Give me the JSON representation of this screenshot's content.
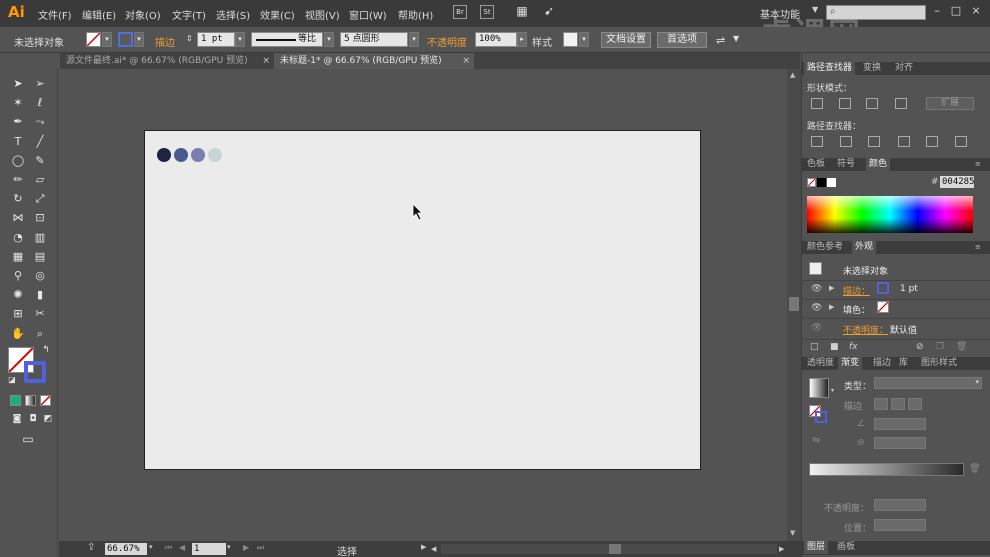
{
  "app": {
    "logo": "Ai",
    "workspace": "基本功能"
  },
  "menu": [
    "文件(F)",
    "编辑(E)",
    "对象(O)",
    "文字(T)",
    "选择(S)",
    "效果(C)",
    "视图(V)",
    "窗口(W)",
    "帮助(H)"
  ],
  "menubar_buttons": {
    "br": "Br",
    "st": "St"
  },
  "watermark": "虎课网",
  "control": {
    "selection": "未选择对象",
    "stroke_label": "描边",
    "stroke_value": "1 pt",
    "stroke_profile": "等比",
    "brush": "5 点圆形",
    "opacity_label": "不透明度",
    "opacity_value": "100%",
    "style_label": "样式",
    "doc_setup": "文档设置",
    "prefs": "首选项"
  },
  "tabs": [
    {
      "label": "源文件最终.ai* @ 66.67% (RGB/GPU 预览)",
      "close": "×"
    },
    {
      "label": "未标题-1* @ 66.67% (RGB/GPU 预览)",
      "close": "×"
    }
  ],
  "tools": [
    "selection-icon",
    "direct-selection-icon",
    "magic-wand-icon",
    "lasso-icon",
    "pen-icon",
    "curvature-icon",
    "type-icon",
    "line-icon",
    "ellipse-icon",
    "paintbrush-icon",
    "pencil-icon",
    "eraser-icon",
    "rotate-icon",
    "scale-icon",
    "width-icon",
    "free-transform-icon",
    "shape-builder-icon",
    "perspective-icon",
    "mesh-icon",
    "gradient-icon",
    "eyedropper-icon",
    "blend-icon",
    "symbol-sprayer-icon",
    "column-graph-icon",
    "artboard-icon",
    "slice-icon",
    "hand-icon",
    "zoom-icon"
  ],
  "swatches": [
    "#1f2440",
    "#4a5a90",
    "#7b7fb0",
    "#c9d6d8"
  ],
  "status": {
    "zoom": "66.67%",
    "page": "1",
    "tool": "选择"
  },
  "panels": {
    "pathfinder_tabs": [
      "路径查找器",
      "变换",
      "对齐"
    ],
    "shape_modes": "形状模式：",
    "expand": "扩展",
    "pathfinders": "路径查找器：",
    "color_tabs": [
      "色板",
      "符号",
      "颜色"
    ],
    "hex": "004285",
    "appearance_tabs": [
      "颜色参考",
      "外观"
    ],
    "appearance": {
      "title": "未选择对象",
      "stroke_label": "描边：",
      "stroke_value": "1 pt",
      "fill_label": "填色：",
      "opacity_label": "不透明度：",
      "opacity_value": "默认值"
    },
    "gradient_tabs": [
      "透明度",
      "渐变",
      "描边",
      "库",
      "图形样式"
    ],
    "gradient": {
      "type_label": "类型：",
      "stroke_label": "描边",
      "opacity_label": "不透明度：",
      "position_label": "位置："
    },
    "layers_tabs": [
      "图层",
      "画板"
    ]
  }
}
